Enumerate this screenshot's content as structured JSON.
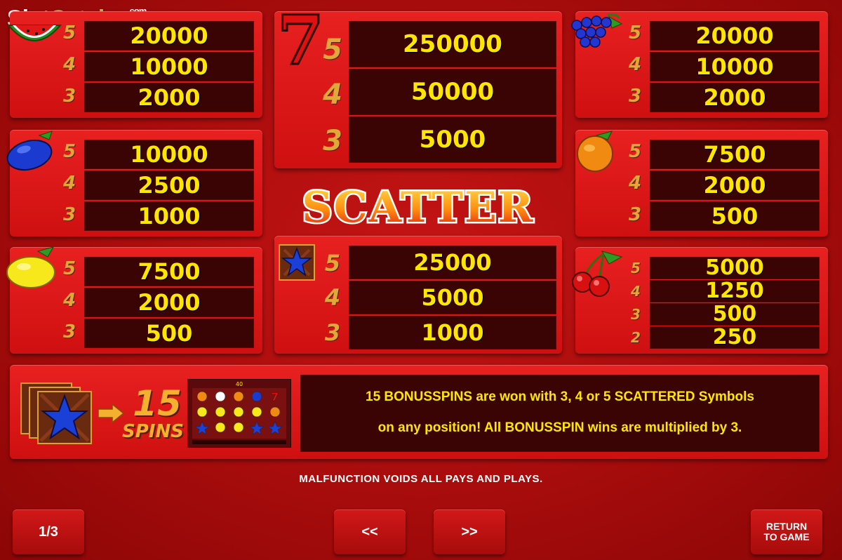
{
  "logo": {
    "part1": "Slot",
    "part2": "Catalog",
    "suffix": ".com"
  },
  "paytable": {
    "watermelon": {
      "rows": [
        {
          "count": "5",
          "value": "20000"
        },
        {
          "count": "4",
          "value": "10000"
        },
        {
          "count": "3",
          "value": "2000"
        }
      ]
    },
    "seven": {
      "symbol": "7",
      "rows": [
        {
          "count": "5",
          "value": "250000"
        },
        {
          "count": "4",
          "value": "50000"
        },
        {
          "count": "3",
          "value": "5000"
        }
      ]
    },
    "grapes": {
      "rows": [
        {
          "count": "5",
          "value": "20000"
        },
        {
          "count": "4",
          "value": "10000"
        },
        {
          "count": "3",
          "value": "2000"
        }
      ]
    },
    "plum": {
      "rows": [
        {
          "count": "5",
          "value": "10000"
        },
        {
          "count": "4",
          "value": "2500"
        },
        {
          "count": "3",
          "value": "1000"
        }
      ]
    },
    "orange": {
      "rows": [
        {
          "count": "5",
          "value": "7500"
        },
        {
          "count": "4",
          "value": "2000"
        },
        {
          "count": "3",
          "value": "500"
        }
      ]
    },
    "lemon": {
      "rows": [
        {
          "count": "5",
          "value": "7500"
        },
        {
          "count": "4",
          "value": "2000"
        },
        {
          "count": "3",
          "value": "500"
        }
      ]
    },
    "star": {
      "rows": [
        {
          "count": "5",
          "value": "25000"
        },
        {
          "count": "4",
          "value": "5000"
        },
        {
          "count": "3",
          "value": "1000"
        }
      ]
    },
    "cherry": {
      "rows": [
        {
          "count": "5",
          "value": "5000"
        },
        {
          "count": "4",
          "value": "1250"
        },
        {
          "count": "3",
          "value": "500"
        },
        {
          "count": "2",
          "value": "250"
        }
      ]
    }
  },
  "scatter_title": "SCATTER",
  "bonus": {
    "spins_number": "15",
    "spins_label": "SPINS",
    "preview_top": "40",
    "text_line1": "15 BONUSSPINS are won with 3, 4 or 5 SCATTERED Symbols",
    "text_line2": "on any position! All BONUSSPIN wins are multiplied by 3."
  },
  "disclaimer": "MALFUNCTION VOIDS ALL PAYS AND PLAYS.",
  "nav": {
    "page_indicator": "1/3",
    "prev_label": "<<",
    "next_label": ">>",
    "return_line1": "RETURN",
    "return_line2": "TO GAME"
  },
  "colors": {
    "background": "#b00e0e",
    "panel": "#dc1616",
    "value_bg": "#3a0404",
    "value_text": "#ffe600",
    "count_text": "#e0a838"
  }
}
